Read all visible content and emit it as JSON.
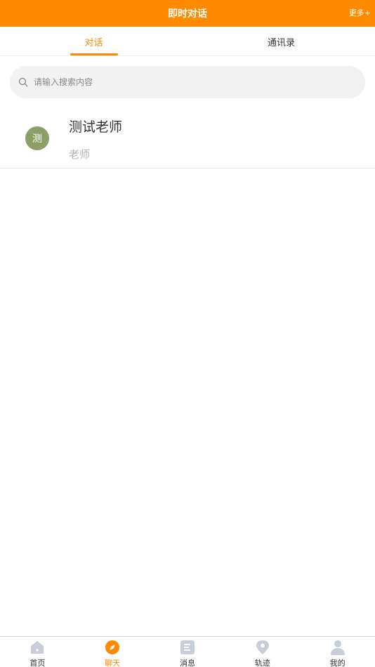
{
  "header": {
    "title": "即时对话",
    "more_label": "更多+"
  },
  "tabs": [
    {
      "label": "对话",
      "active": true
    },
    {
      "label": "通讯录",
      "active": false
    }
  ],
  "search": {
    "placeholder": "请输入搜索内容",
    "value": ""
  },
  "conversations": [
    {
      "avatar_text": "测",
      "avatar_color": "#8aa066",
      "name": "测试老师",
      "subtitle": "老师"
    }
  ],
  "bottom_nav": [
    {
      "label": "首页",
      "icon": "home-icon",
      "active": false
    },
    {
      "label": "聊天",
      "icon": "compass-icon",
      "active": true
    },
    {
      "label": "消息",
      "icon": "document-icon",
      "active": false
    },
    {
      "label": "轨迹",
      "icon": "location-pin-icon",
      "active": false
    },
    {
      "label": "我的",
      "icon": "user-icon",
      "active": false
    }
  ],
  "colors": {
    "accent": "#ff8a00",
    "inactive_icon": "#c7cdd9",
    "avatar": "#8aa066"
  }
}
